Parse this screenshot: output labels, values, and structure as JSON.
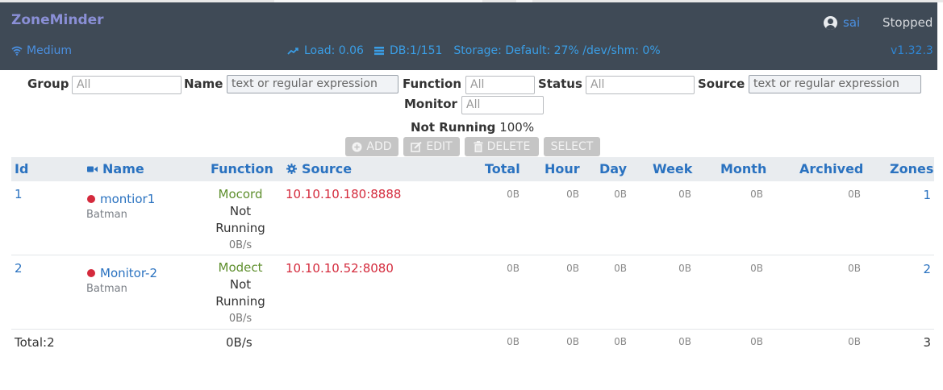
{
  "header": {
    "brand": "ZoneMinder",
    "user": "sai",
    "run_state": "Stopped",
    "bandwidth": "Medium",
    "load": "Load: 0.06",
    "db": "DB:1/151",
    "storage": "Storage: Default: 27% /dev/shm: 0%",
    "version": "v1.32.3",
    "colors": {
      "navbar": "#3f4a56",
      "link": "#4a8fe0",
      "brand": "#8a8fd6"
    }
  },
  "filters": {
    "group_label": "Group",
    "group_value": "All",
    "name_label": "Name",
    "name_placeholder": "text or regular expression",
    "function_label": "Function",
    "function_value": "All",
    "status_label": "Status",
    "status_value": "All",
    "source_label": "Source",
    "source_placeholder": "text or regular expression",
    "monitor_label": "Monitor",
    "monitor_value": "All"
  },
  "summary": {
    "state": "Not Running",
    "percent": "100%"
  },
  "actions": {
    "add": "ADD",
    "edit": "EDIT",
    "delete": "DELETE",
    "select": "SELECT"
  },
  "table": {
    "columns": {
      "id": "Id",
      "name": "Name",
      "function": "Function",
      "source": "Source",
      "total": "Total",
      "hour": "Hour",
      "day": "Day",
      "week": "Week",
      "month": "Month",
      "archived": "Archived",
      "zones": "Zones"
    },
    "rows": [
      {
        "id": "1",
        "name": "montior1",
        "group": "Batman",
        "function": "Mocord",
        "status_line1": "Not",
        "status_line2": "Running",
        "rate": "0B/s",
        "source": "10.10.10.180:8888",
        "total": "0B",
        "hour": "0B",
        "day": "0B",
        "week": "0B",
        "month": "0B",
        "archived": "0B",
        "zones": "1"
      },
      {
        "id": "2",
        "name": "Monitor-2",
        "group": "Batman",
        "function": "Modect",
        "status_line1": "Not",
        "status_line2": "Running",
        "rate": "0B/s",
        "source": "10.10.10.52:8080",
        "total": "0B",
        "hour": "0B",
        "day": "0B",
        "week": "0B",
        "month": "0B",
        "archived": "0B",
        "zones": "2"
      }
    ],
    "footer": {
      "label": "Total:2",
      "rate": "0B/s",
      "total": "0B",
      "hour": "0B",
      "day": "0B",
      "week": "0B",
      "month": "0B",
      "archived": "0B",
      "zones": "3"
    }
  }
}
